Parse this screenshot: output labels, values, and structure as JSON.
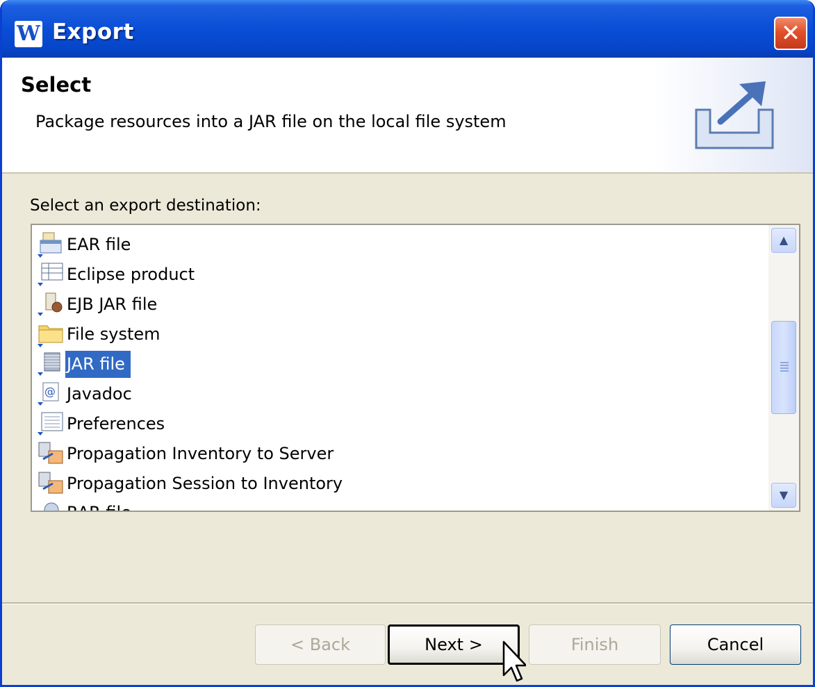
{
  "window": {
    "title": "Export",
    "app_icon_letter": "W"
  },
  "banner": {
    "title": "Select",
    "description": "Package resources into a JAR file on the local file system"
  },
  "destination": {
    "label": "Select an export destination:",
    "items": [
      {
        "label": "EAR file",
        "icon": "ear-file-icon"
      },
      {
        "label": "Eclipse product",
        "icon": "eclipse-product-icon"
      },
      {
        "label": "EJB JAR file",
        "icon": "ejb-jar-icon"
      },
      {
        "label": "File system",
        "icon": "folder-icon"
      },
      {
        "label": "JAR file",
        "icon": "jar-file-icon",
        "selected": true
      },
      {
        "label": "Javadoc",
        "icon": "javadoc-icon"
      },
      {
        "label": "Preferences",
        "icon": "preferences-icon"
      },
      {
        "label": "Propagation Inventory to Server",
        "icon": "propagation-icon"
      },
      {
        "label": "Propagation Session to Inventory",
        "icon": "propagation-icon"
      },
      {
        "label": "RAR file",
        "icon": "rar-file-icon"
      }
    ]
  },
  "buttons": {
    "back": "< Back",
    "next": "Next >",
    "finish": "Finish",
    "cancel": "Cancel"
  },
  "colors": {
    "titlebar": "#0a4ed6",
    "selection": "#316ac5",
    "dialog_bg": "#ece9d8",
    "close": "#e0502b"
  }
}
